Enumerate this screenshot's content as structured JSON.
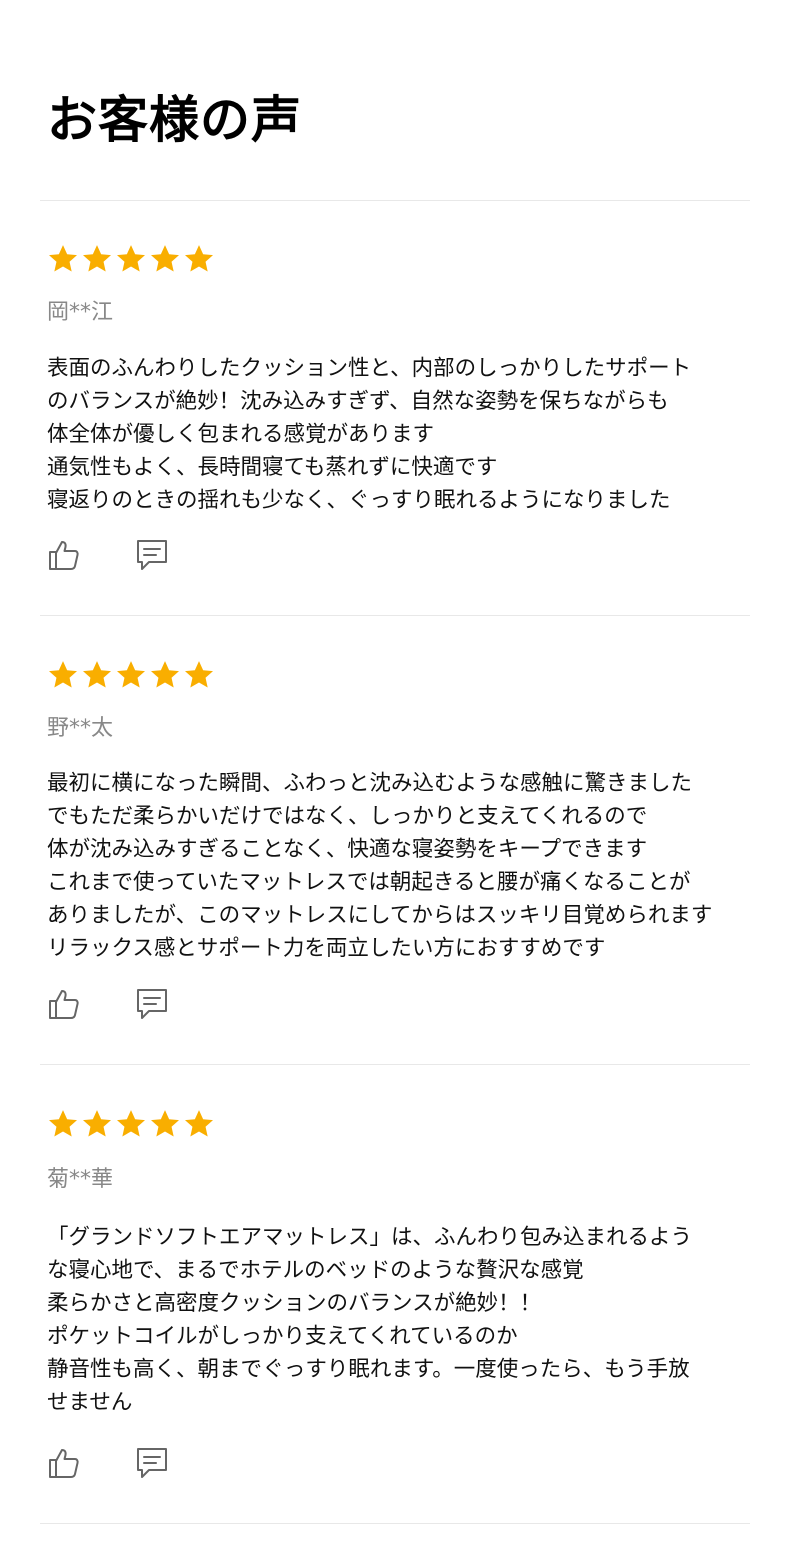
{
  "page": {
    "title": "お客様の声"
  },
  "colors": {
    "star": "#F9AE00",
    "reviewer": "#888888",
    "text": "#111111",
    "icon": "#666666",
    "divider": "#E8E8E8"
  },
  "reviews": [
    {
      "rating": 5,
      "reviewer": "岡**江",
      "lines": [
        "表面のふんわりしたクッション性と、内部のしっかりしたサポート",
        "のバランスが絶妙！沈み込みすぎず、自然な姿勢を保ちながらも",
        "体全体が優しく包まれる感覚があります",
        "通気性もよく、長時間寝ても蒸れずに快適です",
        "寝返りのときの揺れも少なく、ぐっすり眠れるようになりました"
      ],
      "like_icon": "thumbs-up-icon",
      "comment_icon": "comment-icon"
    },
    {
      "rating": 5,
      "reviewer": "野**太",
      "lines": [
        "最初に横になった瞬間、ふわっと沈み込むような感触に驚きました",
        "でもただ柔らかいだけではなく、しっかりと支えてくれるので",
        "体が沈み込みすぎることなく、快適な寝姿勢をキープできます",
        "これまで使っていたマットレスでは朝起きると腰が痛くなることが",
        "ありましたが、このマットレスにしてからはスッキリ目覚められます",
        "リラックス感とサポート力を両立したい方におすすめです"
      ],
      "like_icon": "thumbs-up-icon",
      "comment_icon": "comment-icon"
    },
    {
      "rating": 5,
      "reviewer": "菊**華",
      "lines": [
        "「グランドソフトエアマットレス」は、ふんわり包み込まれるよう",
        "な寝心地で、まるでホテルのベッドのような贅沢な感覚",
        "柔らかさと高密度クッションのバランスが絶妙！！",
        "ポケットコイルがしっかり支えてくれているのか",
        "静音性も高く、朝までぐっすり眠れます。一度使ったら、もう手放",
        "せません"
      ],
      "like_icon": "thumbs-up-icon",
      "comment_icon": "comment-icon"
    }
  ]
}
